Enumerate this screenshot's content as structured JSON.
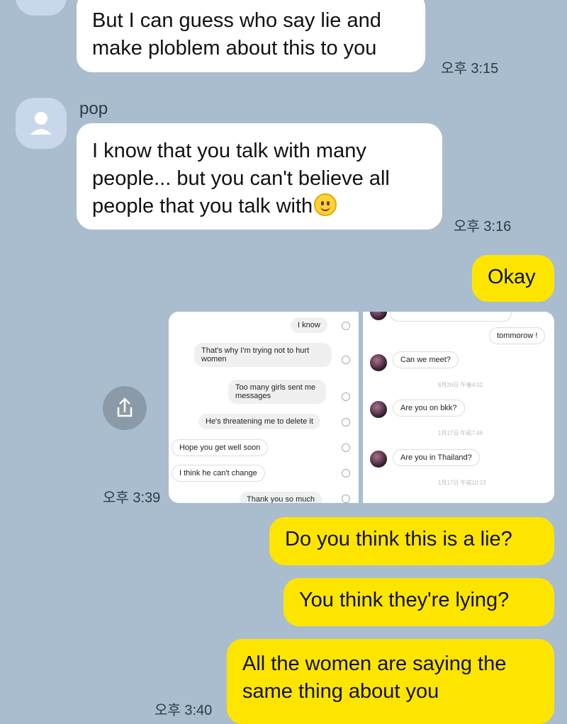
{
  "messages": {
    "m1": {
      "text": "But I can guess who say lie and make ploblem about this to you",
      "time": "오후 3:15"
    },
    "sender_name": "pop",
    "m2": {
      "text": "I know that you talk with many people... but you can't believe all people that you talk with",
      "time": "오후 3:16"
    },
    "m3": {
      "text": "Okay"
    },
    "m4": {
      "time": "오후 3:39"
    },
    "m5": {
      "text": "Do you think this is a lie?"
    },
    "m6": {
      "text": "You think they're lying?"
    },
    "m7": {
      "text": "All the women are saying the same thing about you",
      "time": "오후 3:40"
    }
  },
  "shared_image": {
    "left": {
      "msgs": [
        "I know",
        "That's why I'm trying not to hurt women",
        "Too many girls sent me messages",
        "He's threatening me to delete it",
        "Hope you get well soon",
        "I think he can't change",
        "Thank you so much"
      ]
    },
    "right": {
      "msgs": [
        "tommorow !",
        "Can we meet?",
        "Are you on bkk?",
        "Are you in Thailand?"
      ],
      "stamps": [
        "8月26日 午後4:02",
        "1月17日 午前7:46",
        "1月17日 午前10:13"
      ]
    }
  },
  "icons": {
    "avatar": "person-silhouette-icon",
    "share": "share-upload-icon",
    "emoji": "smiling-face-emoji"
  },
  "colors": {
    "background": "#a9bdcf",
    "incoming": "#ffffff",
    "outgoing": "#fee500"
  }
}
